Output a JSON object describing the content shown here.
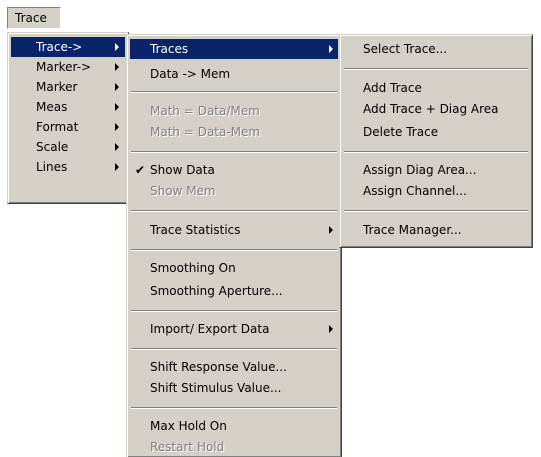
{
  "menubar": {
    "trace_label": "Trace"
  },
  "menu_level1": {
    "items": [
      {
        "label": "Trace->"
      },
      {
        "label": "Marker->"
      },
      {
        "label": "Marker"
      },
      {
        "label": "Meas"
      },
      {
        "label": "Format"
      },
      {
        "label": "Scale"
      },
      {
        "label": "Lines"
      }
    ]
  },
  "menu_level2": {
    "items": [
      {
        "label": "Traces"
      },
      {
        "label": "Data -> Mem"
      },
      {
        "label": "Math = Data/Mem"
      },
      {
        "label": "Math = Data-Mem"
      },
      {
        "label": "Show Data"
      },
      {
        "label": "Show Mem"
      },
      {
        "label": "Trace Statistics"
      },
      {
        "label": "Smoothing On"
      },
      {
        "label": "Smoothing Aperture..."
      },
      {
        "label": "Import/ Export Data"
      },
      {
        "label": "Shift Response Value..."
      },
      {
        "label": "Shift Stimulus Value..."
      },
      {
        "label": "Max Hold On"
      },
      {
        "label": "Restart Hold"
      }
    ]
  },
  "menu_level3": {
    "items": [
      {
        "label": "Select Trace..."
      },
      {
        "label": "Add Trace"
      },
      {
        "label": "Add Trace + Diag Area"
      },
      {
        "label": "Delete Trace"
      },
      {
        "label": "Assign Diag Area..."
      },
      {
        "label": "Assign Channel..."
      },
      {
        "label": "Trace Manager..."
      }
    ]
  },
  "icons": {
    "submenu": "submenu-arrow-icon",
    "check": "checkmark-icon"
  },
  "colors": {
    "menu_bg": "#d4d0c8",
    "highlight": "#0a246a",
    "disabled_text": "#808080"
  }
}
